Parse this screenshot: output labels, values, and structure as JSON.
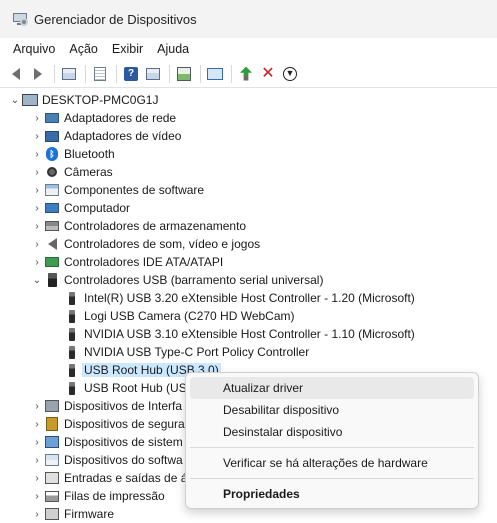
{
  "window": {
    "title": "Gerenciador de Dispositivos"
  },
  "menu": [
    "Arquivo",
    "Ação",
    "Exibir",
    "Ajuda"
  ],
  "tree": {
    "root": "DESKTOP-PMC0G1J",
    "categories": [
      {
        "label": "Adaptadores de rede",
        "icon": "network-adapter-icon"
      },
      {
        "label": "Adaptadores de vídeo",
        "icon": "display-adapter-icon"
      },
      {
        "label": "Bluetooth",
        "icon": "bluetooth-icon"
      },
      {
        "label": "Câmeras",
        "icon": "camera-icon"
      },
      {
        "label": "Componentes de software",
        "icon": "software-component-icon"
      },
      {
        "label": "Computador",
        "icon": "computer-icon"
      },
      {
        "label": "Controladores de armazenamento",
        "icon": "storage-controller-icon"
      },
      {
        "label": "Controladores de som, vídeo e jogos",
        "icon": "sound-icon"
      },
      {
        "label": "Controladores IDE ATA/ATAPI",
        "icon": "ide-controller-icon"
      },
      {
        "label": "Controladores USB (barramento serial universal)",
        "icon": "usb-controller-icon"
      }
    ],
    "usb_children": [
      "Intel(R) USB 3.20 eXtensible Host Controller - 1.20 (Microsoft)",
      "Logi USB Camera (C270 HD WebCam)",
      "NVIDIA USB 3.10 eXtensible Host Controller - 1.10 (Microsoft)",
      "NVIDIA USB Type-C Port Policy Controller",
      "USB Root Hub (USB 3.0)",
      "USB Root Hub (USI"
    ],
    "after": [
      {
        "label": "Dispositivos de Interfa",
        "icon": "hid-icon"
      },
      {
        "label": "Dispositivos de segura",
        "icon": "security-device-icon"
      },
      {
        "label": "Dispositivos de sistem",
        "icon": "system-device-icon"
      },
      {
        "label": "Dispositivos do softwa",
        "icon": "software-device-icon"
      },
      {
        "label": "Entradas e saídas de áu",
        "icon": "audio-io-icon"
      },
      {
        "label": "Filas de impressão",
        "icon": "print-queue-icon"
      },
      {
        "label": "Firmware",
        "icon": "firmware-icon"
      }
    ]
  },
  "context_menu": {
    "items": [
      "Atualizar driver",
      "Desabilitar dispositivo",
      "Desinstalar dispositivo"
    ],
    "scan": "Verificar se há alterações de hardware",
    "properties": "Propriedades"
  }
}
